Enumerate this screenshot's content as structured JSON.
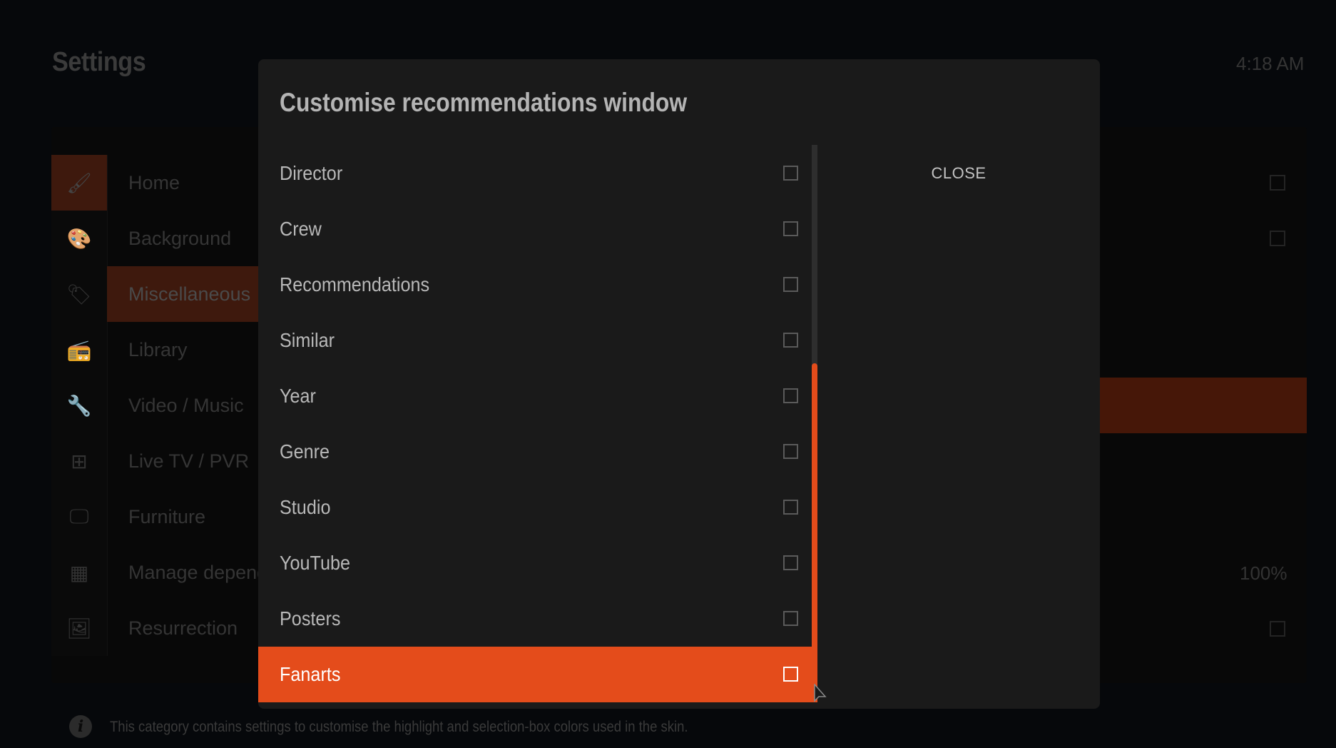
{
  "header": {
    "title": "Settings",
    "clock": "4:18 AM"
  },
  "sidebar": {
    "items": [
      {
        "label": "Home",
        "icon": "paintbrush-icon",
        "glyph": "🖌",
        "active_icon": true
      },
      {
        "label": "Background",
        "icon": "palette-icon",
        "glyph": "🎨"
      },
      {
        "label": "Miscellaneous",
        "icon": "tag-icon",
        "glyph": "🏷",
        "selected": true
      },
      {
        "label": "Library",
        "icon": "receiver-icon",
        "glyph": "📻"
      },
      {
        "label": "Video / Music",
        "icon": "wrench-icon",
        "glyph": "🔧"
      },
      {
        "label": "Live TV / PVR",
        "icon": "network-icon",
        "glyph": "⊞"
      },
      {
        "label": "Furniture",
        "icon": "remote-display-icon",
        "glyph": "🖵"
      },
      {
        "label": "Manage dependencies",
        "icon": "cpu-icon",
        "glyph": "▦"
      },
      {
        "label": "Resurrection",
        "icon": "photos-icon",
        "glyph": "🖼"
      }
    ]
  },
  "background_settings": {
    "value_label": "100%"
  },
  "footer": {
    "info_icon": "i",
    "text": "This category contains settings to customise the highlight and selection-box colors used in the skin."
  },
  "dialog": {
    "title": "Customise recommendations window",
    "close_label": "CLOSE",
    "items": [
      {
        "label": "Director",
        "checked": false
      },
      {
        "label": "Crew",
        "checked": false
      },
      {
        "label": "Recommendations",
        "checked": false
      },
      {
        "label": "Similar",
        "checked": false
      },
      {
        "label": "Year",
        "checked": false
      },
      {
        "label": "Genre",
        "checked": false
      },
      {
        "label": "Studio",
        "checked": false
      },
      {
        "label": "YouTube",
        "checked": false
      },
      {
        "label": "Posters",
        "checked": false
      },
      {
        "label": "Fanarts",
        "checked": false,
        "selected": true
      }
    ],
    "scroll_position_fraction": 0.6,
    "scroll_thumb_fraction": 0.6
  },
  "colors": {
    "accent": "#e44c1b",
    "dim_accent": "#461708",
    "dialog_bg": "#1a1a1a"
  }
}
